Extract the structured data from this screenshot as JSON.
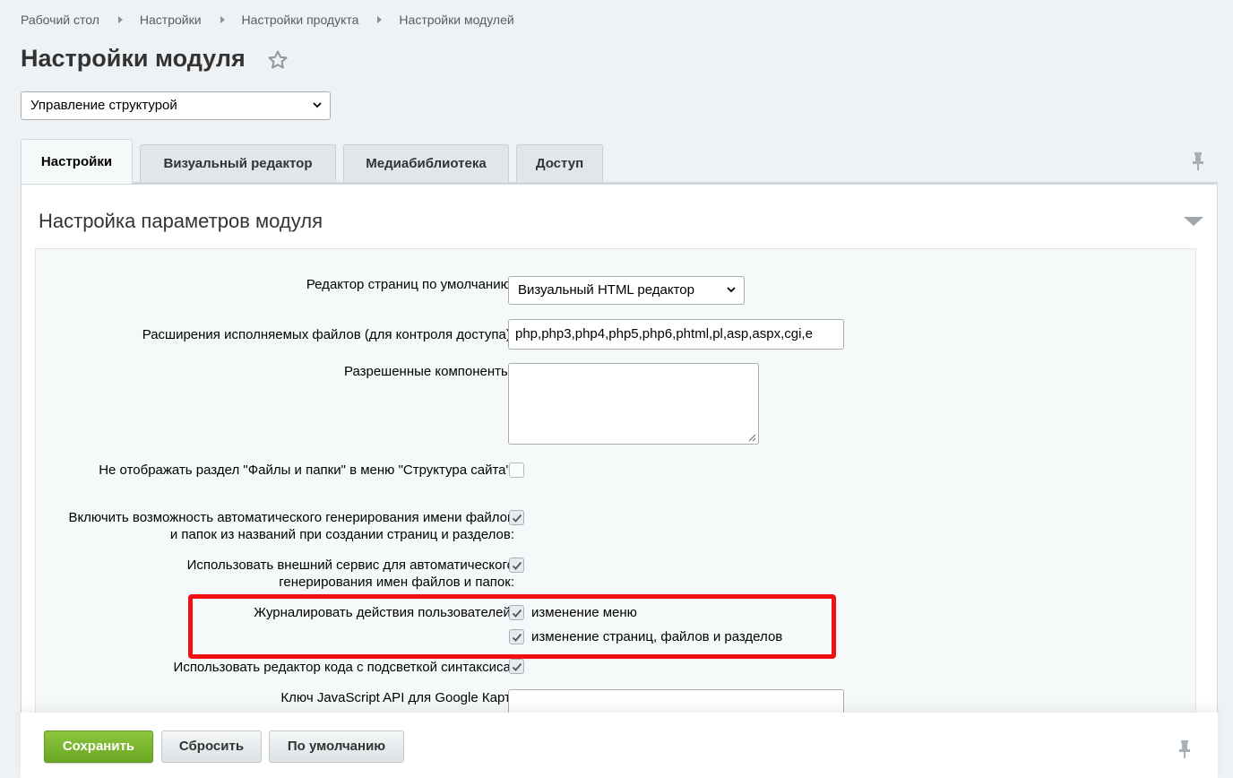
{
  "breadcrumb": [
    "Рабочий стол",
    "Настройки",
    "Настройки продукта",
    "Настройки модулей"
  ],
  "page_title": "Настройки модуля",
  "module_select": {
    "value": "Управление структурой"
  },
  "tabs": [
    {
      "label": "Настройки",
      "active": true
    },
    {
      "label": "Визуальный редактор",
      "active": false
    },
    {
      "label": "Медиабиблиотека",
      "active": false
    },
    {
      "label": "Доступ",
      "active": false
    }
  ],
  "section_title": "Настройка параметров модуля",
  "fields": {
    "default_editor": {
      "label": "Редактор страниц по умолчанию:",
      "value": "Визуальный HTML редактор"
    },
    "exec_extensions": {
      "label": "Расширения исполняемых файлов (для контроля доступа):",
      "value": "php,php3,php4,php5,php6,phtml,pl,asp,aspx,cgi,e"
    },
    "allowed_components": {
      "label": "Разрешенные компоненты:",
      "value": ""
    },
    "hide_files_section": {
      "label": "Не отображать раздел \"Файлы и папки\" в меню \"Структура сайта\":",
      "checked": false
    },
    "auto_generate_names": {
      "label": "Включить возможность автоматического генерирования имени файлов и папок из названий при создании страниц и разделов:",
      "checked": true
    },
    "external_service": {
      "label": "Использовать внешний сервис для автоматического генерирования имен файлов и папок:",
      "checked": true
    },
    "log_actions": {
      "label": "Журналировать действия пользователей:",
      "options": [
        {
          "label": "изменение меню",
          "checked": true
        },
        {
          "label": "изменение страниц, файлов и разделов",
          "checked": true
        }
      ]
    },
    "code_highlight": {
      "label": "Использовать редактор кода с подсветкой синтаксиса:",
      "checked": true
    },
    "google_maps_key": {
      "label": "Ключ JavaScript API для Google Карт:",
      "value": ""
    }
  },
  "buttons": {
    "save": "Сохранить",
    "reset": "Сбросить",
    "default": "По умолчанию"
  },
  "colors": {
    "accent_green": "#7ab52f",
    "highlight_red": "#f20f0f",
    "link": "#535c69"
  }
}
